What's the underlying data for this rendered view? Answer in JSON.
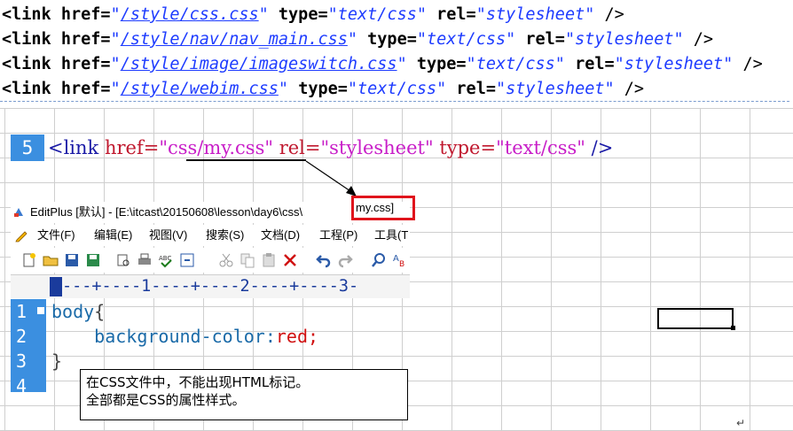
{
  "top_code": {
    "lines": [
      {
        "href": "/style/css.css",
        "type": "text/css",
        "rel": "stylesheet"
      },
      {
        "href": "/style/nav/nav_main.css",
        "type": "text/css",
        "rel": "stylesheet"
      },
      {
        "href": "/style/image/imageswitch.css",
        "type": "text/css",
        "rel": "stylesheet"
      },
      {
        "href": "/style/webim.css",
        "type": "text/css",
        "rel": "stylesheet"
      }
    ],
    "tag_open": "<link",
    "attr_href": "href=",
    "attr_type": "type=",
    "attr_rel": "rel=",
    "tag_close": "/>"
  },
  "line5": {
    "number": "5",
    "tag_open": "<link",
    "attr_href": "href=",
    "href_value": "\"css/my.css\"",
    "attr_rel": "rel=",
    "rel_value": "\"stylesheet\"",
    "attr_type": "type=",
    "type_value": "\"text/css\"",
    "tag_close": "/>"
  },
  "editplus": {
    "title_prefix": "EditPlus [默认] - [E:\\itcast\\20150608\\lesson\\day6\\css\\",
    "title_file": "my.css]",
    "menu": [
      "文件(F)",
      "编辑(E)",
      "视图(V)",
      "搜索(S)",
      "文档(D)",
      "工程(P)",
      "工具(T"
    ],
    "ruler": "---+----1----+----2----+----3-",
    "gutter": [
      "1",
      "2",
      "3",
      "4"
    ],
    "code": {
      "selector": "body",
      "open_brace": "{",
      "property": "background-color:",
      "value": "red;",
      "close_brace": "}"
    }
  },
  "note": {
    "line1": "在CSS文件中，不能出现HTML标记。",
    "line2": "全部都是CSS的属性样式。"
  },
  "colors": {
    "gutter_blue": "#3b8fe0",
    "highlight_red": "#e0141c",
    "url_blue": "#1e3cff",
    "string_magenta": "#c81ec8"
  }
}
